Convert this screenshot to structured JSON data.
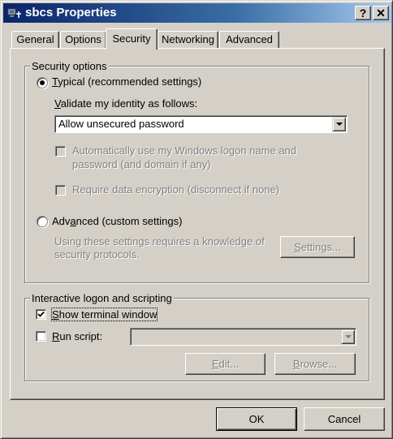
{
  "window": {
    "title": "sbcs Properties",
    "help_button": "?",
    "close_button": "✕"
  },
  "tabs": [
    {
      "label": "General"
    },
    {
      "label": "Options"
    },
    {
      "label": "Security"
    },
    {
      "label": "Networking"
    },
    {
      "label": "Advanced"
    }
  ],
  "security_options": {
    "legend": "Security options",
    "typical": {
      "mnemonic": "T",
      "label_rest": "ypical (recommended settings)",
      "selected": true
    },
    "validate": {
      "mnemonic": "V",
      "label_rest": "alidate my identity as follows:"
    },
    "identity_select": {
      "value": "Allow unsecured password"
    },
    "auto_logon": {
      "line1": "Automatically use my Windows logon name and",
      "line2": "password (and domain if any)",
      "checked": false
    },
    "require_encryption": {
      "label": "Require data encryption (disconnect if none)",
      "checked": false
    },
    "advanced": {
      "pre": "Adv",
      "mnemonic": "a",
      "post": "nced (custom settings)",
      "selected": false
    },
    "advanced_note": {
      "line1": "Using these settings requires a knowledge of",
      "line2": "security protocols."
    },
    "settings_button": {
      "mnemonic": "S",
      "label_rest": "ettings..."
    }
  },
  "interactive": {
    "legend": "Interactive logon and scripting",
    "show_terminal": {
      "mnemonic": "S",
      "label_rest": "how terminal window",
      "checked": true
    },
    "run_script": {
      "mnemonic": "R",
      "label_rest": "un script:",
      "checked": false
    },
    "script_select": {
      "value": ""
    },
    "edit_button": {
      "mnemonic": "E",
      "label_rest": "dit..."
    },
    "browse_button": {
      "mnemonic": "B",
      "label_rest": "rowse..."
    }
  },
  "footer": {
    "ok_label": "OK",
    "cancel_label": "Cancel"
  }
}
